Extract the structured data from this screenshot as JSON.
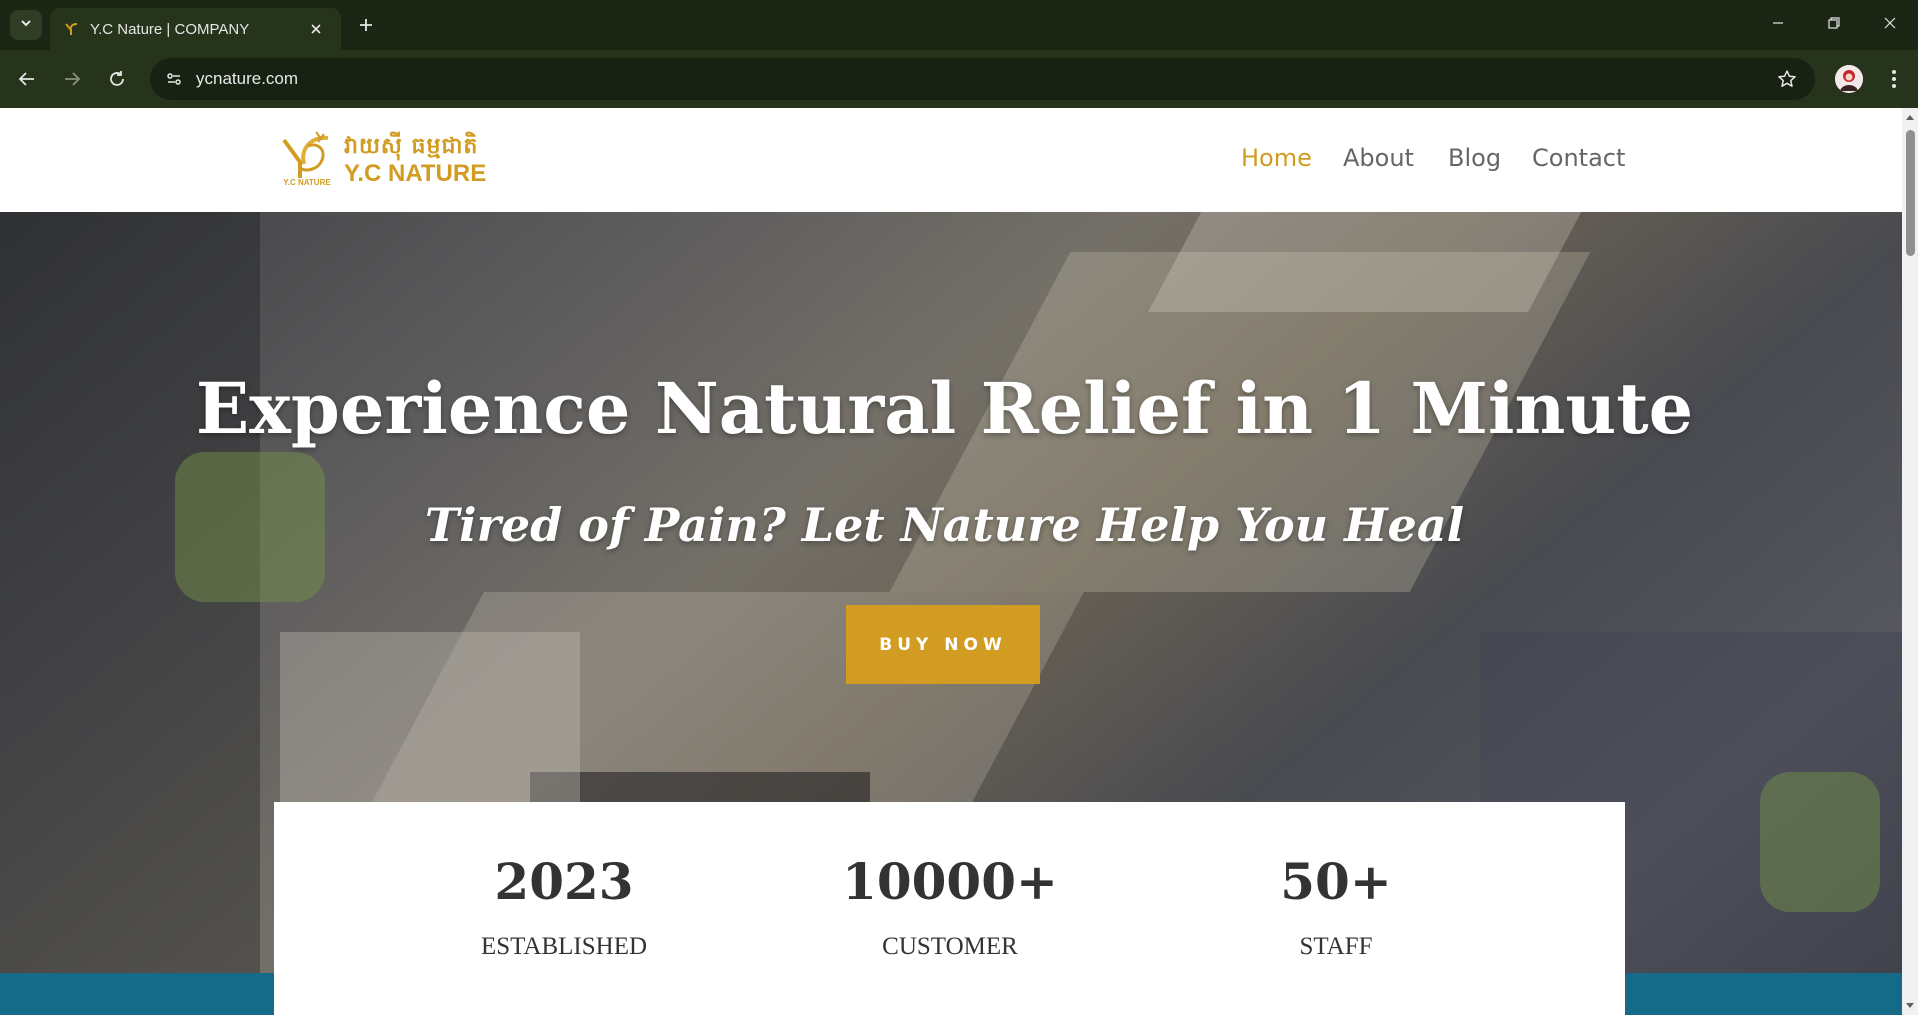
{
  "browser": {
    "tab": {
      "title": "Y.C Nature | COMPANY"
    },
    "url": "ycnature.com",
    "icons": {
      "tab_list": "chevron-down-icon",
      "favicon": "yc-nature-favicon",
      "tab_close": "close-icon",
      "new_tab": "plus-icon",
      "minimize": "minimize-icon",
      "restore": "restore-icon",
      "close_window": "close-window-icon",
      "back": "back-arrow-icon",
      "forward": "forward-arrow-icon",
      "reload": "reload-icon",
      "site_info": "site-settings-icon",
      "bookmark": "star-icon",
      "profile": "profile-avatar",
      "menu": "vertical-dots-icon"
    }
  },
  "site": {
    "logo": {
      "khmer_text": "វាយស៊ី ធម្មជាតិ",
      "latin_text": "Y.C NATURE",
      "mark_text": "Y.C NATURE",
      "color": "#d19c21"
    },
    "nav": [
      {
        "label": "Home",
        "active": true
      },
      {
        "label": "About",
        "active": false
      },
      {
        "label": "Blog",
        "active": false
      },
      {
        "label": "Contact",
        "active": false
      }
    ],
    "hero": {
      "title": "Experience Natural Relief in 1 Minute",
      "subtitle": "Tired of Pain? Let Nature Help You Heal",
      "cta_label": "BUY NOW"
    },
    "stats": [
      {
        "value": "2023",
        "label": "ESTABLISHED"
      },
      {
        "value": "10000+",
        "label": "CUSTOMER"
      },
      {
        "value": "50+",
        "label": "STAFF"
      }
    ],
    "colors": {
      "accent": "#d19c21",
      "band": "#156a87",
      "nav_text": "#666666"
    }
  }
}
